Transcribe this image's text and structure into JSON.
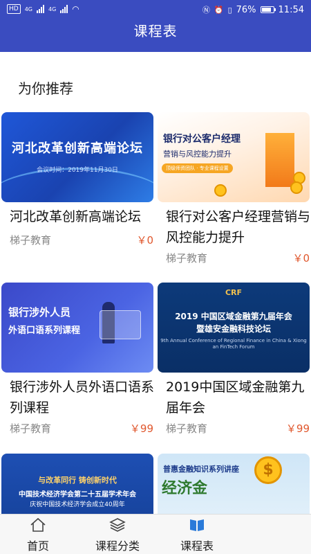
{
  "status_bar": {
    "left_badge": "HD",
    "signal_labels": [
      "4G",
      "4G"
    ],
    "battery": "76%",
    "time": "11:54"
  },
  "header": {
    "title": "课程表"
  },
  "section": {
    "title": "为你推荐"
  },
  "courses": [
    {
      "title": "河北改革创新高端论坛",
      "provider": "梯子教育",
      "price": "￥0",
      "thumb": {
        "headline": "河北改革创新高端论坛",
        "sub": "会议时间：2019年11月30日"
      }
    },
    {
      "title": "银行对公客户经理营销与风控能力提升",
      "provider": "梯子教育",
      "price": "￥0",
      "thumb": {
        "line1": "银行对公客户经理",
        "line2": "营销与风控能力提升",
        "pill": "顶级师资团队 · 专业课程设置"
      }
    },
    {
      "title": "银行涉外人员外语口语系列课程",
      "provider": "梯子教育",
      "price": "￥99",
      "thumb": {
        "line1": "银行涉外人员",
        "line2": "外语口语系列课程"
      }
    },
    {
      "title": "2019中国区域金融第九届年会",
      "provider": "梯子教育",
      "price": "￥99",
      "thumb": {
        "logo": "CRF",
        "line1": "2019 中国区域金融第九届年会",
        "line2": "暨雄安金融科技论坛",
        "en": "9th Annual Conference of Regional Finance in China & Xiong an FinTech Forum"
      }
    },
    {
      "title": "",
      "provider": "",
      "price": "",
      "thumb": {
        "line0": "与改革同行  铸创新时代",
        "line1": "中国技术经济学会第二十五届学术年会",
        "line2": "庆祝中国技术经济学会成立40周年"
      }
    },
    {
      "title": "",
      "provider": "",
      "price": "",
      "thumb": {
        "line1": "普惠金融知识系列讲座",
        "line2": "经济金",
        "coin": "$"
      }
    }
  ],
  "bottom_nav": [
    {
      "label": "首页",
      "icon": "home-icon"
    },
    {
      "label": "课程分类",
      "icon": "layers-icon"
    },
    {
      "label": "课程表",
      "icon": "book-icon"
    }
  ],
  "colors": {
    "header": "#3a4cc0",
    "price": "#e0572d",
    "provider": "#888888"
  }
}
